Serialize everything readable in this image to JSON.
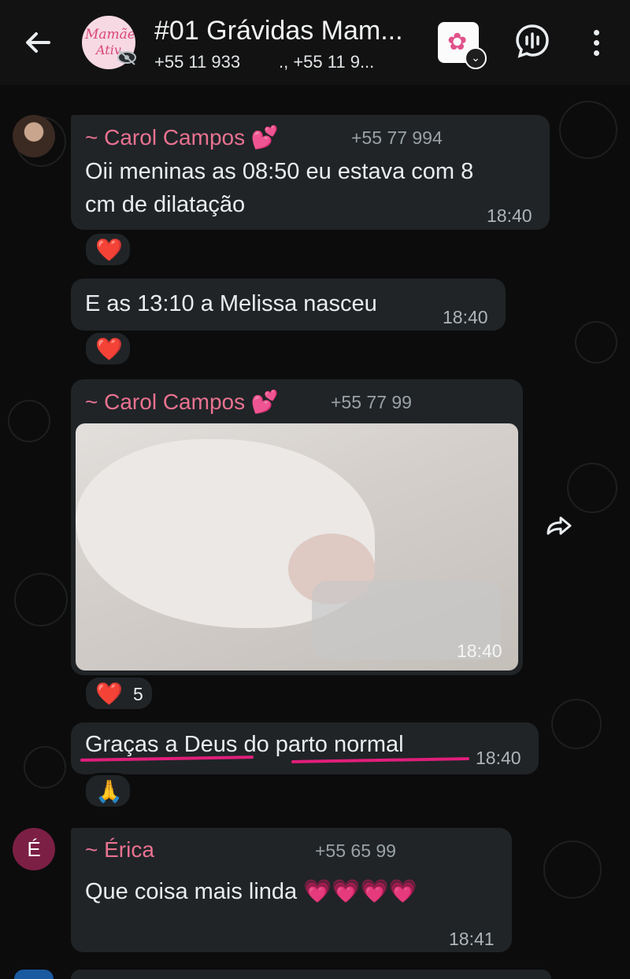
{
  "header": {
    "group_name": "#01 Grávidas Mam...",
    "members": "+55 11 933 ⁠ ⁠ ⁠ ⁠ ⁠ ⁠ ⁠ ., +55 11 9...",
    "avatar_line1": "Mamãe",
    "avatar_line2": "Ativ",
    "icons": [
      "back-arrow-icon",
      "eye-off-icon",
      "sticker-icon",
      "voice-call-icon",
      "more-options-icon"
    ]
  },
  "messages": [
    {
      "sender": "~ Carol Campos 💕",
      "phone": "+55 77 994",
      "text_line1": "Oii meninas as 08:50 eu estava com 8",
      "text_line2": "cm de dilatação",
      "time": "18:40",
      "reaction": "❤️"
    },
    {
      "text": "E as 13:10 a Melissa nasceu",
      "time": "18:40",
      "reaction": "❤️"
    },
    {
      "sender": "~ Carol Campos 💕",
      "phone": "+55 77 99",
      "image_time": "18:40",
      "reaction": "❤️",
      "reaction_count": "5"
    },
    {
      "text": "Graças a Deus do parto normal",
      "time": "18:40",
      "reaction": "🙏"
    },
    {
      "avatar_letter": "É",
      "sender": "~ Érica",
      "phone": "+55 65 99",
      "text": "Que coisa mais linda 💗💗💗💗",
      "time": "18:41"
    }
  ],
  "colors": {
    "sender": "#e97290",
    "bubble": "#202427",
    "underline": "#e01e7a"
  }
}
